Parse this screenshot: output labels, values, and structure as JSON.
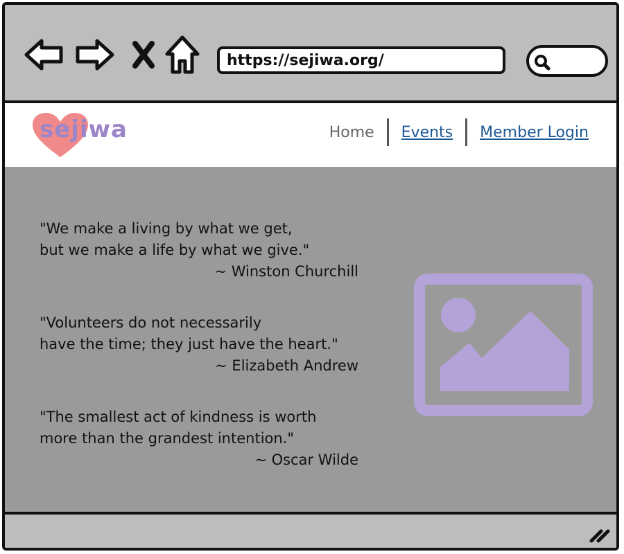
{
  "browser": {
    "url": "https://sejiwa.org/",
    "icons": [
      "back-arrow-icon",
      "forward-arrow-icon",
      "close-icon",
      "home-icon",
      "search-icon",
      "resize-handle-icon"
    ]
  },
  "site": {
    "logo_text": "sejiwa",
    "brand_color": "#9b85c9",
    "heart_color": "#f08a8a",
    "nav": {
      "home": "Home",
      "events": "Events",
      "member_login": "Member Login"
    }
  },
  "quotes": [
    {
      "line1": "\"We make a living by what we get,",
      "line2": "but we make a life by what we give.\"",
      "author": "~ Winston Churchill"
    },
    {
      "line1": "\"Volunteers do not necessarily",
      "line2": "have the time; they just have the heart.\"",
      "author": "~ Elizabeth Andrew"
    },
    {
      "line1": "\"The smallest act of kindness is worth",
      "line2": "more than the grandest intention.\"",
      "author": "~ Oscar Wilde"
    }
  ]
}
